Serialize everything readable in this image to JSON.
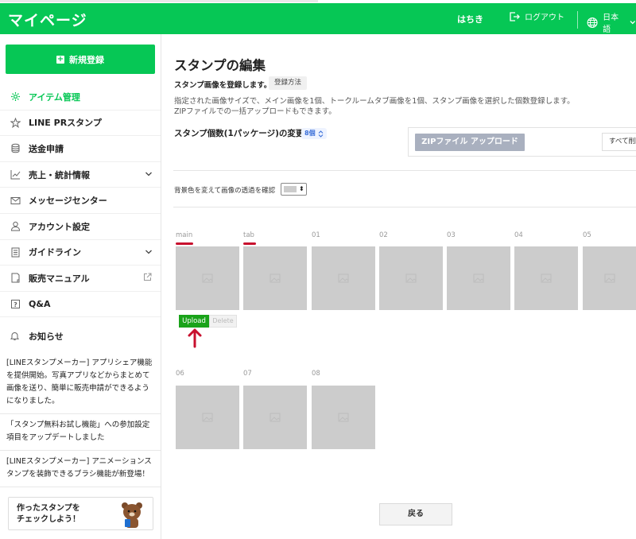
{
  "header": {
    "title": "マイページ",
    "user_name": "はちき",
    "logout_label": "ログアウト",
    "language_label": "日本語"
  },
  "sidebar": {
    "new_button_label": "新規登録",
    "items": [
      {
        "label": "アイテム管理",
        "icon": "gear-icon",
        "active": true
      },
      {
        "label": "LINE PRスタンプ",
        "icon": "star-icon"
      },
      {
        "label": "送金申請",
        "icon": "coins-icon"
      },
      {
        "label": "売上・統計情報",
        "icon": "chart-icon"
      },
      {
        "label": "メッセージセンター",
        "icon": "mail-icon"
      },
      {
        "label": "アカウント設定",
        "icon": "person-icon"
      },
      {
        "label": "ガイドライン",
        "icon": "document-icon"
      },
      {
        "label": "販売マニュアル",
        "icon": "book-icon"
      },
      {
        "label": "Q&A",
        "icon": "question-icon"
      }
    ],
    "news_heading": "お知らせ",
    "news": [
      "[LINEスタンプメーカー] アプリシェア機能を提供開始。写真アプリなどからまとめて画像を送り、簡単に販売申請ができるようになりました。",
      "「スタンプ無料お試し機能」への参加設定項目をアップデートしました",
      "[LINEスタンプメーカー] アニメーションスタンプを装飾できるブラシ機能が新登場！"
    ],
    "banner_line1": "作ったスタンプを",
    "banner_line2": "チェックしよう！"
  },
  "main": {
    "title": "スタンプの編集",
    "subtitle": "スタンプ画像を登録します。",
    "howto_label": "登録方法",
    "desc_line1": "指定された画像サイズで、メイン画像を1個、トークルームタブ画像を1個、スタンプ画像を選択した個数登録します。",
    "desc_line2": "ZIPファイルでの一括アップロードもできます。",
    "count_label": "スタンプ個数(1パッケージ)の変更",
    "count_value": "8個",
    "zip_button_label": "ZIPファイル アップロード",
    "delete_all_label": "すべて削除",
    "bg_label": "背景色を変えて画像の透過を確認",
    "slot_labels": [
      "main",
      "tab",
      "01",
      "02",
      "03",
      "04",
      "05",
      "06",
      "07",
      "08"
    ],
    "upload_label": "Upload",
    "delete_label": "Delete",
    "back_label": "戻る"
  },
  "colors": {
    "line_green": "#06c755",
    "upload_green": "#1aa31a",
    "annotation_red": "#c8102e",
    "slot_gray": "#cccccc"
  }
}
